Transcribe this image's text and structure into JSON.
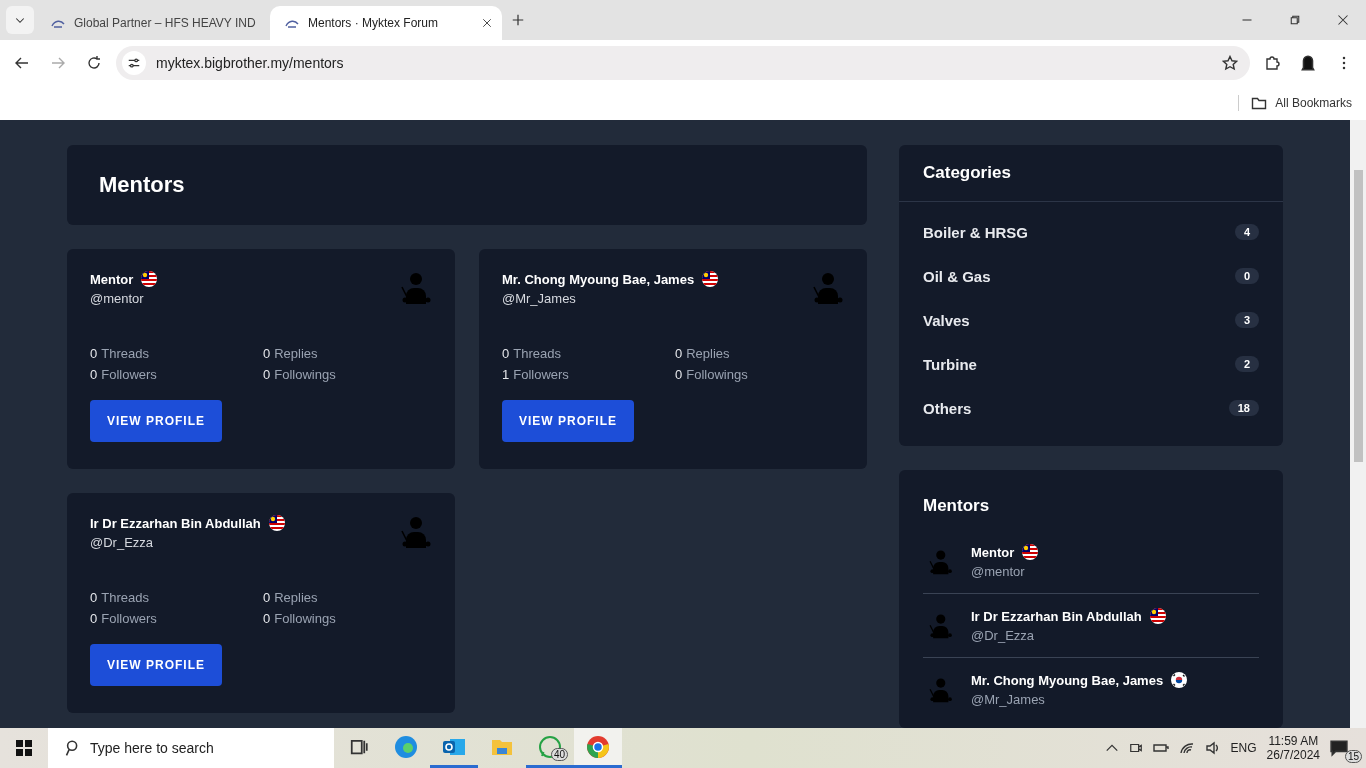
{
  "browser": {
    "tabs": [
      {
        "title": "Global Partner – HFS HEAVY IND",
        "selected": false
      },
      {
        "title": "Mentors · Myktex Forum",
        "selected": true
      }
    ],
    "url": "myktex.bigbrother.my/mentors",
    "bookmarks": [
      {
        "label": "All Bookmarks"
      }
    ]
  },
  "page_title": "Mentors",
  "mentor_cards": [
    {
      "name": "Mentor",
      "kind": "my_flag",
      "handle": "@mentor",
      "stats": [
        {
          "count": "0",
          "label": "Threads"
        },
        {
          "count": "0",
          "label": "Replies"
        },
        {
          "count": "0",
          "label": "Followers"
        },
        {
          "count": "0",
          "label": "Followings"
        }
      ],
      "button": "VIEW PROFILE"
    },
    {
      "name": "Mr. Chong Myoung Bae, James",
      "kind": "my_flag",
      "handle": "@Mr_James",
      "stats": [
        {
          "count": "0",
          "label": "Threads"
        },
        {
          "count": "0",
          "label": "Replies"
        },
        {
          "count": "1",
          "label": "Followers"
        },
        {
          "count": "0",
          "label": "Followings"
        }
      ],
      "button": "VIEW PROFILE"
    },
    {
      "name": "Ir Dr Ezzarhan Bin Abdullah",
      "kind": "my_flag",
      "handle": "@Dr_Ezza",
      "stats": [
        {
          "count": "0",
          "label": "Threads"
        },
        {
          "count": "0",
          "label": "Replies"
        },
        {
          "count": "0",
          "label": "Followers"
        },
        {
          "count": "0",
          "label": "Followings"
        }
      ],
      "button": "VIEW PROFILE"
    }
  ],
  "categories": {
    "title": "Categories",
    "items": [
      {
        "name": "Boiler & HRSG",
        "count": "4"
      },
      {
        "name": "Oil & Gas",
        "count": "0"
      },
      {
        "name": "Valves",
        "count": "3"
      },
      {
        "name": "Turbine",
        "count": "2"
      },
      {
        "name": "Others",
        "count": "18"
      }
    ]
  },
  "mentors_list": {
    "title": "Mentors",
    "items": [
      {
        "name": "Mentor",
        "kind": "my_flag",
        "handle": "@mentor"
      },
      {
        "name": "Ir Dr Ezzarhan Bin Abdullah",
        "kind": "my_flag",
        "handle": "@Dr_Ezza"
      },
      {
        "name": "Mr. Chong Myoung Bae, James",
        "kind": "kr_flag",
        "handle": "@Mr_James"
      }
    ]
  },
  "taskbar": {
    "search_placeholder": "Type here to search",
    "whatsapp_badge": "40",
    "time": "11:59 AM",
    "date": "26/7/2024",
    "language": "ENG",
    "notifications": "15"
  }
}
